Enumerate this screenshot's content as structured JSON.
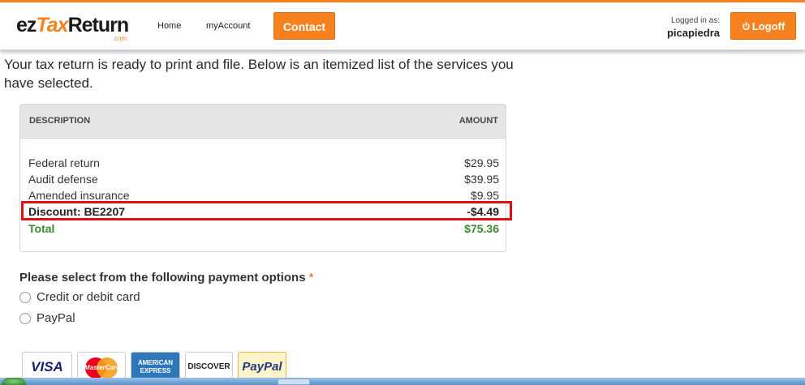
{
  "header": {
    "logo_pre": "ez",
    "logo_tax": "Tax",
    "logo_post": "Return",
    "logo_suffix": ".com",
    "nav": [
      "Home",
      "myAccount"
    ],
    "contact_label": "Contact",
    "logged_in_label": "Logged in as:",
    "username": "picapiedra",
    "logoff_label": "Logoff"
  },
  "intro_text": "Your tax return is ready to print and file. Below is an itemized list of the services you have selected.",
  "summary": {
    "col_description": "DESCRIPTION",
    "col_amount": "AMOUNT",
    "items": [
      {
        "description": "Federal return",
        "amount": "$29.95"
      },
      {
        "description": "Audit defense",
        "amount": "$39.95"
      },
      {
        "description": "Amended insurance",
        "amount": "$9.95"
      }
    ],
    "discount": {
      "description": "Discount: BE2207",
      "amount": "-$4.49"
    },
    "total": {
      "description": "Total",
      "amount": "$75.36"
    }
  },
  "payment": {
    "title": "Please select from the following payment options",
    "required_mark": "*",
    "options": [
      "Credit or debit card",
      "PayPal"
    ]
  },
  "cards": [
    "VISA",
    "MasterCard",
    "AMERICAN EXPRESS",
    "DISCOVER",
    "PayPal"
  ],
  "colors": {
    "accent": "#f7811f",
    "total_green": "#3a8a2e",
    "highlight_red": "#dd1111"
  }
}
